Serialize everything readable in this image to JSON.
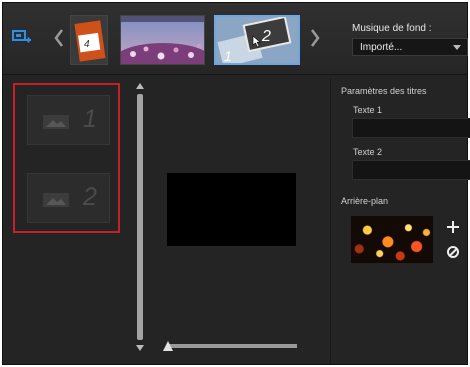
{
  "templates": [
    {
      "name": "template-4-frame",
      "badge": "4"
    },
    {
      "name": "template-flowers",
      "badge": ""
    },
    {
      "name": "template-1-2-frames",
      "badge_a": "1",
      "badge_b": "2"
    }
  ],
  "music": {
    "label": "Musique de fond :",
    "selected": "Importé..."
  },
  "slots": [
    {
      "number": "1"
    },
    {
      "number": "2"
    }
  ],
  "titles": {
    "section": "Paramètres des titres",
    "text1_label": "Texte 1",
    "text1_value": "",
    "text2_label": "Texte 2",
    "text2_value": ""
  },
  "background": {
    "section": "Arrière-plan"
  },
  "colors": {
    "selection_frame": "#c42026",
    "selected_thumb_border": "#6ea6e0",
    "accent_icon": "#2d8ee8"
  }
}
